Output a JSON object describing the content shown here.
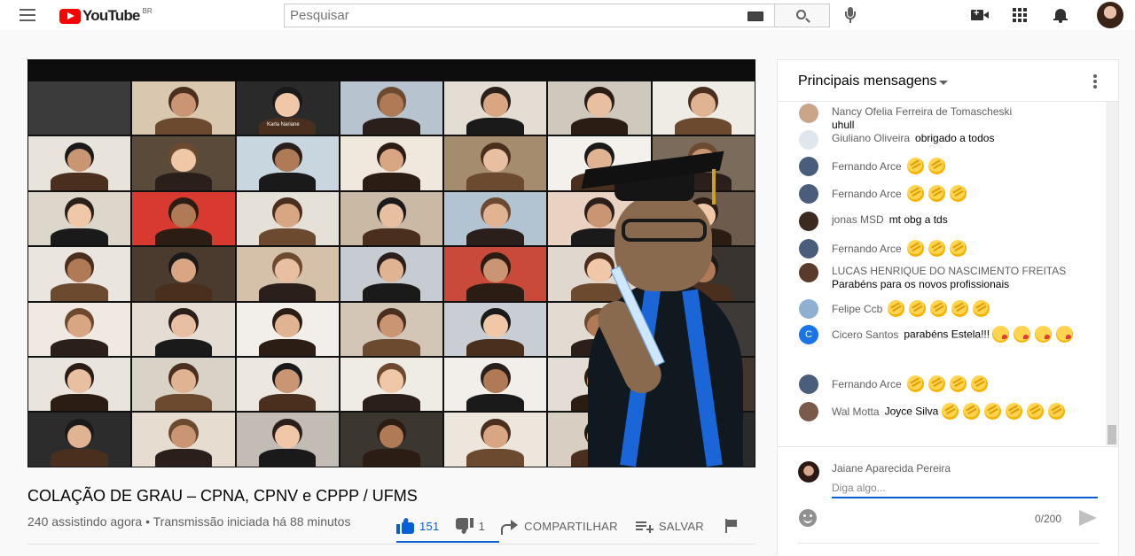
{
  "masthead": {
    "logo_text": "YouTube",
    "country_code": "BR",
    "search_placeholder": "Pesquisar",
    "icons": [
      "menu-icon",
      "keyboard-icon",
      "search-icon",
      "mic-icon",
      "create-video-icon",
      "apps-icon",
      "notifications-icon"
    ]
  },
  "video": {
    "participant_label": "Karla Nariane",
    "title": "COLAÇÃO DE GRAU – CPNA, CPNV e CPPP / UFMS",
    "meta": "240 assistindo agora • Transmissão iniciada há 88 minutos",
    "likes": "151",
    "dislikes": "1",
    "share_label": "COMPARTILHAR",
    "save_label": "SALVAR",
    "accent_color": "#065fd4"
  },
  "chat": {
    "title": "Principais mensagens",
    "messages": [
      {
        "author": "Nancy Ofelia Ferreira de Tomascheski",
        "text": "uhull",
        "emoji": []
      },
      {
        "author": "Giuliano Oliveira",
        "text": "obrigado a todos",
        "emoji": []
      },
      {
        "author": "Fernando Arce",
        "text": "",
        "emoji": [
          "clap",
          "clap"
        ]
      },
      {
        "author": "Fernando Arce",
        "text": "",
        "emoji": [
          "clap",
          "clap",
          "clap"
        ]
      },
      {
        "author": "jonas MSD",
        "text": "mt obg a tds",
        "emoji": []
      },
      {
        "author": "Fernando Arce",
        "text": "",
        "emoji": [
          "clap",
          "clap",
          "clap"
        ]
      },
      {
        "author": "LUCAS HENRIQUE DO NASCIMENTO FREITAS",
        "text": "Parabéns para os novos profissionais",
        "emoji": []
      },
      {
        "author": "Felipe Ccb",
        "text": "",
        "emoji": [
          "clap",
          "clap",
          "clap",
          "clap",
          "clap"
        ]
      },
      {
        "author": "Cicero Santos",
        "text": "parabéns Estela!!!",
        "emoji": [
          "kiss",
          "kiss",
          "kiss",
          "kiss"
        ],
        "avatar_letter": "C"
      },
      {
        "author": "Fernando Arce",
        "text": "",
        "emoji": [
          "clap",
          "clap",
          "clap",
          "clap"
        ]
      },
      {
        "author": "Wal Motta",
        "text": "Joyce Silva",
        "emoji": [
          "clap",
          "clap",
          "clap",
          "clap",
          "clap",
          "clap"
        ]
      }
    ],
    "compose": {
      "user_name": "Jaiane Aparecida Pereira",
      "placeholder": "Diga algo...",
      "counter": "0/200"
    }
  }
}
